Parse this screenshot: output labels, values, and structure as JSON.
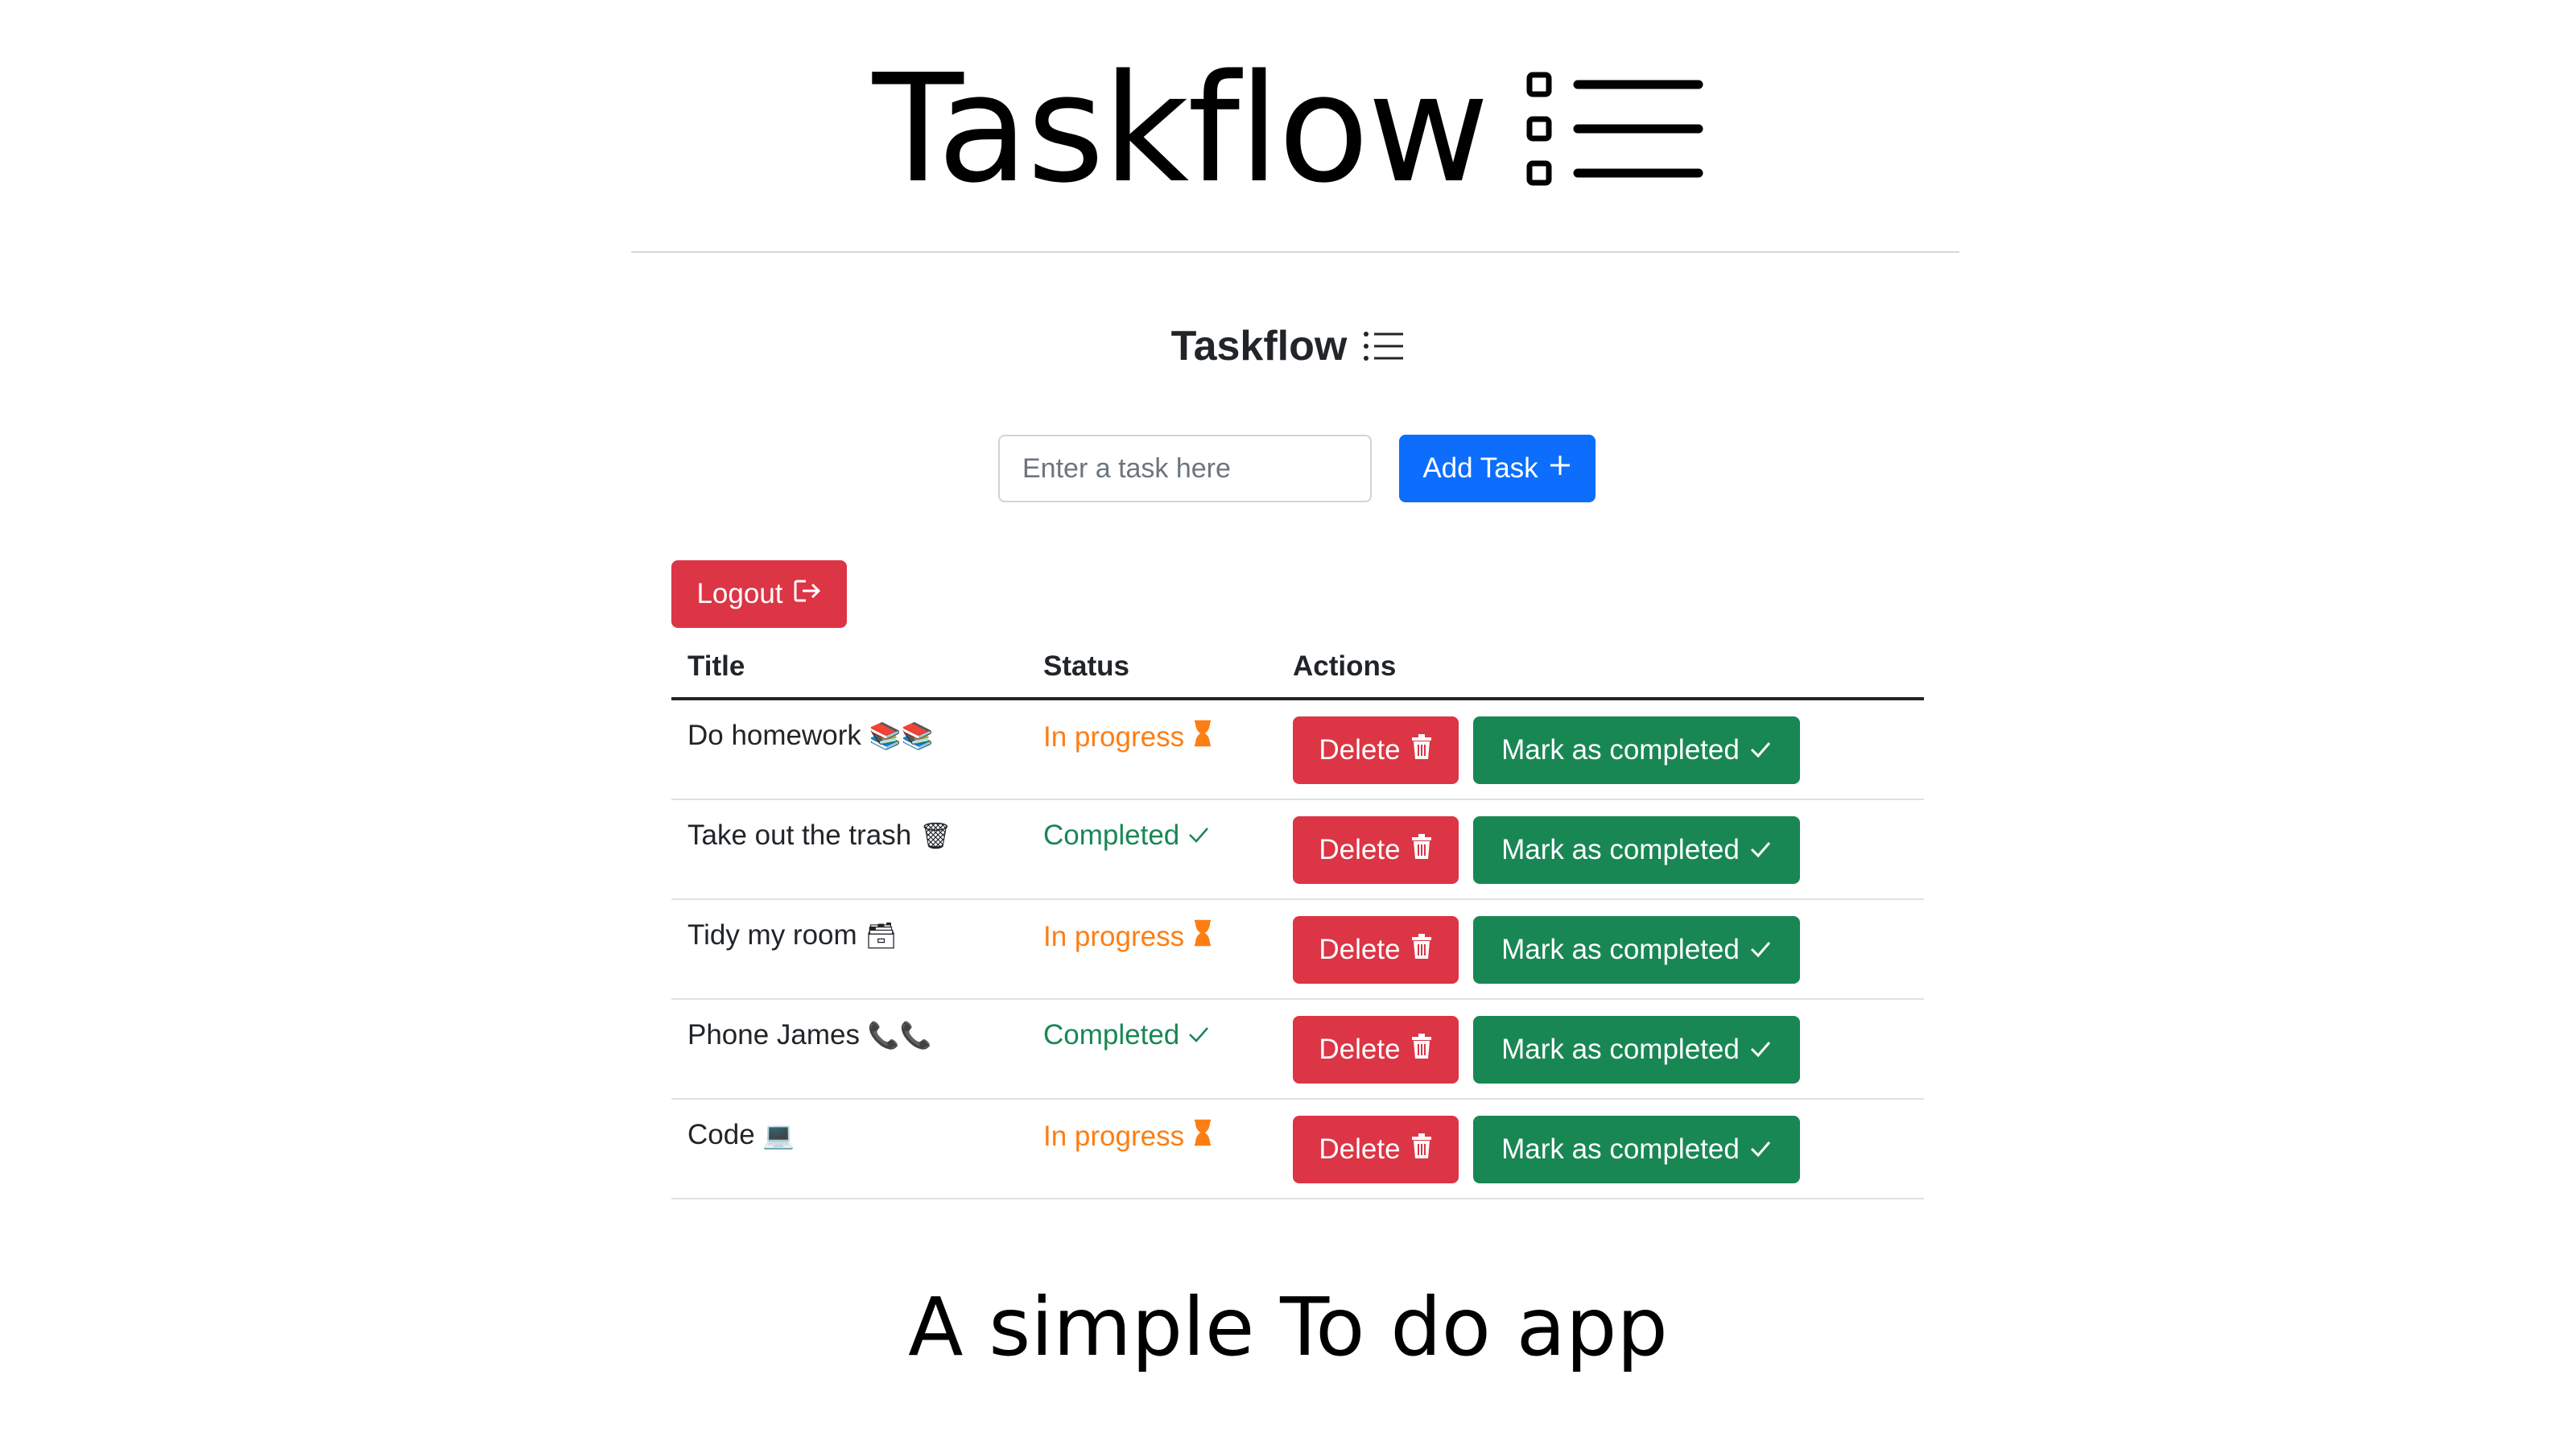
{
  "banner": {
    "title": "Taskflow",
    "icon": "list-icon"
  },
  "app": {
    "title": "Taskflow",
    "title_icon": "list-icon",
    "input_placeholder": "Enter a task here",
    "input_value": "",
    "add_label": "Add Task",
    "add_icon": "plus-icon",
    "logout_label": "Logout",
    "logout_icon": "logout-icon"
  },
  "table": {
    "headers": {
      "title": "Title",
      "status": "Status",
      "actions": "Actions"
    },
    "rows": [
      {
        "title": "Do homework",
        "emoji": "📚📚",
        "status": "In progress",
        "status_icon": "hourglass-icon",
        "delete_label": "Delete",
        "complete_label": "Mark as completed"
      },
      {
        "title": "Take out the trash",
        "emoji": "🗑",
        "status": "Completed",
        "status_icon": "check-icon",
        "delete_label": "Delete",
        "complete_label": "Mark as completed"
      },
      {
        "title": "Tidy my room",
        "emoji": "🗃",
        "status": "In progress",
        "status_icon": "hourglass-icon",
        "delete_label": "Delete",
        "complete_label": "Mark as completed"
      },
      {
        "title": "Phone James",
        "emoji": "📞📞",
        "status": "Completed",
        "status_icon": "check-icon",
        "delete_label": "Delete",
        "complete_label": "Mark as completed"
      },
      {
        "title": "Code",
        "emoji": "💻",
        "status": "In progress",
        "status_icon": "hourglass-icon",
        "delete_label": "Delete",
        "complete_label": "Mark as completed"
      }
    ]
  },
  "tagline": "A simple To do app",
  "colors": {
    "primary": "#0d6efd",
    "danger": "#dc3545",
    "success": "#198754",
    "in_progress": "#fd7e14"
  }
}
